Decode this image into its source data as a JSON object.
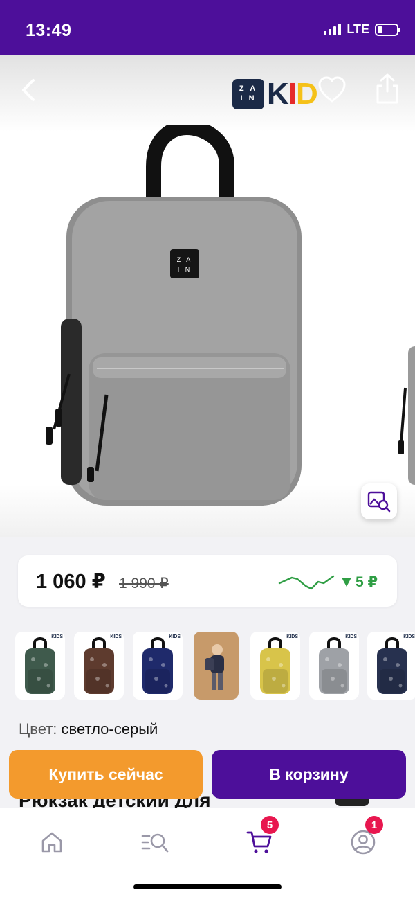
{
  "status_bar": {
    "time": "13:49",
    "network": "LTE"
  },
  "brand": {
    "badge_line1": "Z A",
    "badge_line2": "I N",
    "k": "K",
    "i": "I",
    "d": "D"
  },
  "product": {
    "price_current": "1 060 ₽",
    "price_old": "1 990 ₽",
    "price_drop": "5 ₽",
    "color_label": "Цвет:",
    "color_value": "светло-серый",
    "title_peek": "Рюкзак детский для",
    "patch_line1": "Z A",
    "patch_line2": "I N"
  },
  "variants": [
    {
      "name": "tropical-green",
      "tag": "KIDS",
      "color": "#3f5a4c"
    },
    {
      "name": "brown-print",
      "tag": "KIDS",
      "color": "#5e3b2e"
    },
    {
      "name": "navy",
      "tag": "KIDS",
      "color": "#1f2a6b"
    },
    {
      "name": "child-photo",
      "tag": "",
      "color": "#c79a6a"
    },
    {
      "name": "yellow-print",
      "tag": "KIDS",
      "color": "#d8c44a"
    },
    {
      "name": "grey-camo",
      "tag": "KIDS",
      "color": "#9ea1a6"
    },
    {
      "name": "navy-print",
      "tag": "KIDS",
      "color": "#27314f"
    }
  ],
  "actions": {
    "buy_now": "Купить сейчас",
    "add_to_cart": "В корзину"
  },
  "tab_bar": {
    "cart_badge": "5",
    "profile_badge": "1"
  },
  "colors": {
    "brand_purple": "#4d0f9a",
    "accent_orange": "#f39a2d",
    "badge_red": "#e8174f",
    "trend_green": "#2f9e44"
  }
}
